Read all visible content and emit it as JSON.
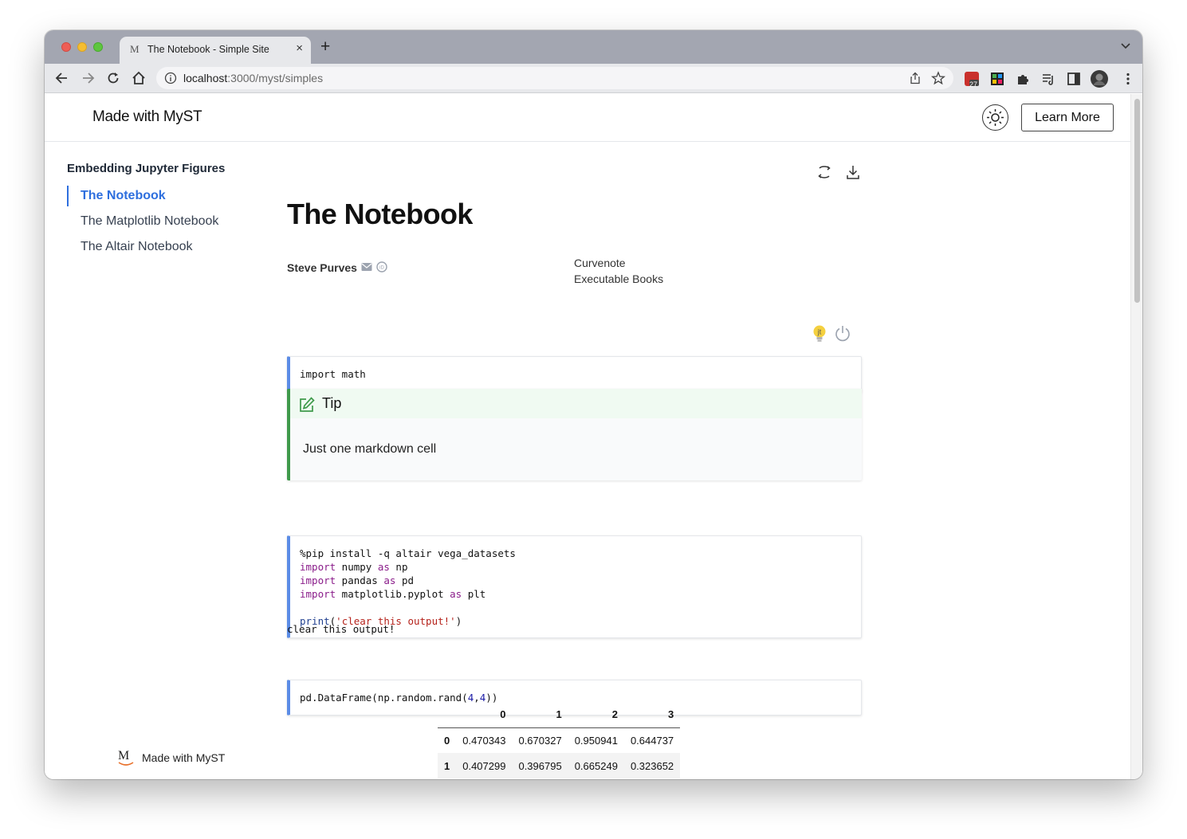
{
  "browser": {
    "tab_favicon": "M",
    "tab_title": "The Notebook - Simple Site",
    "tab_close": "×",
    "new_tab": "+",
    "url_host": "localhost",
    "url_rest": ":3000/myst/simples",
    "extension_badge": "27"
  },
  "header": {
    "brand": "Made with MyST",
    "theme_icon": "sun-icon",
    "learn_more": "Learn More"
  },
  "sidebar": {
    "title": "Embedding Jupyter Figures",
    "items": [
      {
        "label": "The Notebook",
        "active": true
      },
      {
        "label": "The Matplotlib Notebook",
        "active": false
      },
      {
        "label": "The Altair Notebook",
        "active": false
      }
    ],
    "footer_logo": "M",
    "footer_label": "Made with MyST"
  },
  "article": {
    "title": "The Notebook",
    "author": "Steve Purves",
    "affiliations": [
      "Curvenote",
      "Executable Books"
    ],
    "cell1": "import math",
    "tip": {
      "title": "Tip",
      "body": "Just one markdown cell"
    },
    "cell2": {
      "l1": "%pip install -q altair vega_datasets",
      "l2a": "import",
      "l2b": " numpy ",
      "l2c": "as",
      "l2d": " np",
      "l3a": "import",
      "l3b": " pandas ",
      "l3c": "as",
      "l3d": " pd",
      "l4a": "import",
      "l4b": " matplotlib.pyplot ",
      "l4c": "as",
      "l4d": " plt",
      "l6a": "print",
      "l6b": "(",
      "l6c": "'clear this output!'",
      "l6d": ")"
    },
    "output1": "clear this output!",
    "cell3": {
      "a": "pd.DataFrame(np.random.rand(",
      "b": "4",
      "c": ",",
      "d": "4",
      "e": "))"
    },
    "dataframe": {
      "columns": [
        "0",
        "1",
        "2",
        "3"
      ],
      "rows": [
        {
          "index": "0",
          "values": [
            "0.470343",
            "0.670327",
            "0.950941",
            "0.644737"
          ]
        },
        {
          "index": "1",
          "values": [
            "0.407299",
            "0.396795",
            "0.665249",
            "0.323652"
          ]
        }
      ]
    }
  },
  "colors": {
    "accent": "#2e6fde",
    "code_border": "#5b8ce6",
    "tip_border": "#3f9a4b"
  }
}
